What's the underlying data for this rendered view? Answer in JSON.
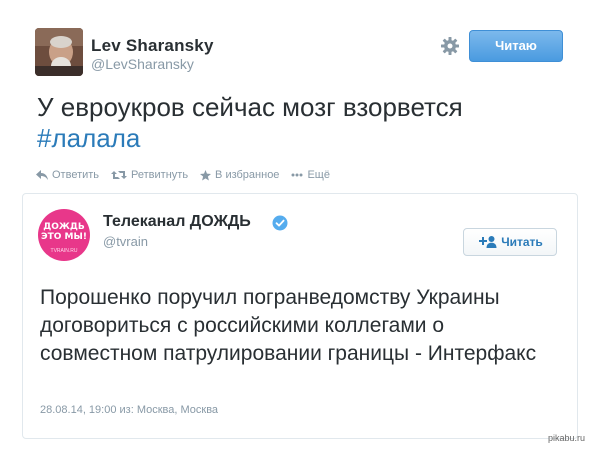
{
  "colors": {
    "accent": "#2b7bb9",
    "follow_button": "#4a9be0",
    "pink_avatar": "#e8378a",
    "muted": "#8899a6"
  },
  "tweet": {
    "author_name": "Lev Sharansky",
    "author_handle": "@LevSharansky",
    "follow_label": "Читаю",
    "text": "У евроукров сейчас мозг взорвется",
    "hashtag": "#лалала",
    "actions": {
      "reply": "Ответить",
      "retweet": "Ретвитнуть",
      "favorite": "В избранное",
      "more": "Ещё"
    }
  },
  "quoted": {
    "author_name": "Телеканал ДОЖДЬ",
    "author_handle": "@tvrain",
    "avatar_text_line1": "ДОЖДЬ",
    "avatar_text_line2": "ЭТО МЫ!",
    "avatar_small": "TVRAIN.RU",
    "follow_label": "Читать",
    "text": "Порошенко поручил погранведомству Украины договориться с российскими коллегами о совместном патрулировании границы - Интерфакс",
    "meta": "28.08.14, 19:00 из: Москва, Москва"
  },
  "watermark": "pikabu.ru"
}
